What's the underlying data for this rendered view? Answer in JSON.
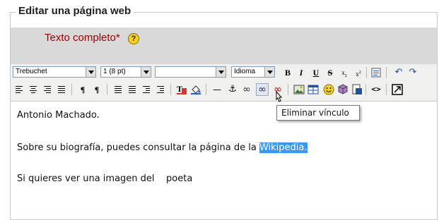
{
  "fieldset": {
    "legend": "Editar una página web"
  },
  "field": {
    "label": "Texto completo",
    "required_mark": "*",
    "help_glyph": "?"
  },
  "toolbar": {
    "font_family": "Trebuchet",
    "font_size": "1 (8 pt)",
    "style_value": "",
    "language": "Idioma",
    "bold": "B",
    "italic": "I",
    "underline": "U",
    "strike": "S",
    "subscript": "x",
    "subscript_sub": "2",
    "superscript": "x",
    "superscript_sup": "2",
    "ltr": "¶",
    "rtl": "¶",
    "hr": "—",
    "anchor": "⚓",
    "link": "∞",
    "unlink": "∞",
    "nolink": "∞",
    "code": "<>"
  },
  "tooltip": {
    "text": "Eliminar vínculo"
  },
  "editor": {
    "line1": "Antonio Machado.",
    "line2_before": "Sobre su biografía, puedes consultar la página de la ",
    "line2_selected": "Wikipedia.",
    "line3": "Si quieres ver una imagen del    poeta"
  },
  "colors": {
    "label_red": "#a00000",
    "selection_blue": "#3399ff",
    "toolbar_bg": "#f0f0ee",
    "label_band_bg": "#d9d9d9"
  }
}
